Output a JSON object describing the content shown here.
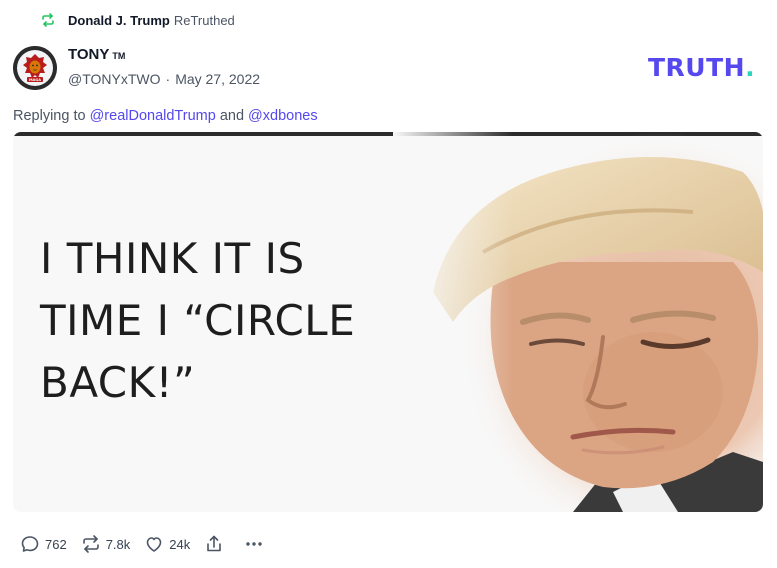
{
  "retruth": {
    "name": "Donald J. Trump",
    "label": "ReTruthed"
  },
  "post": {
    "author": {
      "display_name": "TONY",
      "tm": "TM",
      "handle": "@TONYxTWO",
      "separator": "·",
      "date": "May 27, 2022",
      "avatar_badge": "MAGA"
    },
    "replying": {
      "prefix": "Replying to",
      "mention1": "@realDonaldTrump",
      "conj": "and",
      "mention2": "@xdbones"
    },
    "image": {
      "line1": "I THINK IT IS",
      "line2": "TIME I “CIRCLE",
      "line3": "BACK!”"
    }
  },
  "brand": {
    "logo": "TRUTH",
    "logo_dot": ".",
    "colors": {
      "purple": "#5448ee",
      "teal": "#2dd4bf"
    }
  },
  "actions": {
    "replies": "762",
    "retruths": "7.8k",
    "likes": "24k",
    "share_icon": "share-icon",
    "more_icon": "more-icon"
  }
}
